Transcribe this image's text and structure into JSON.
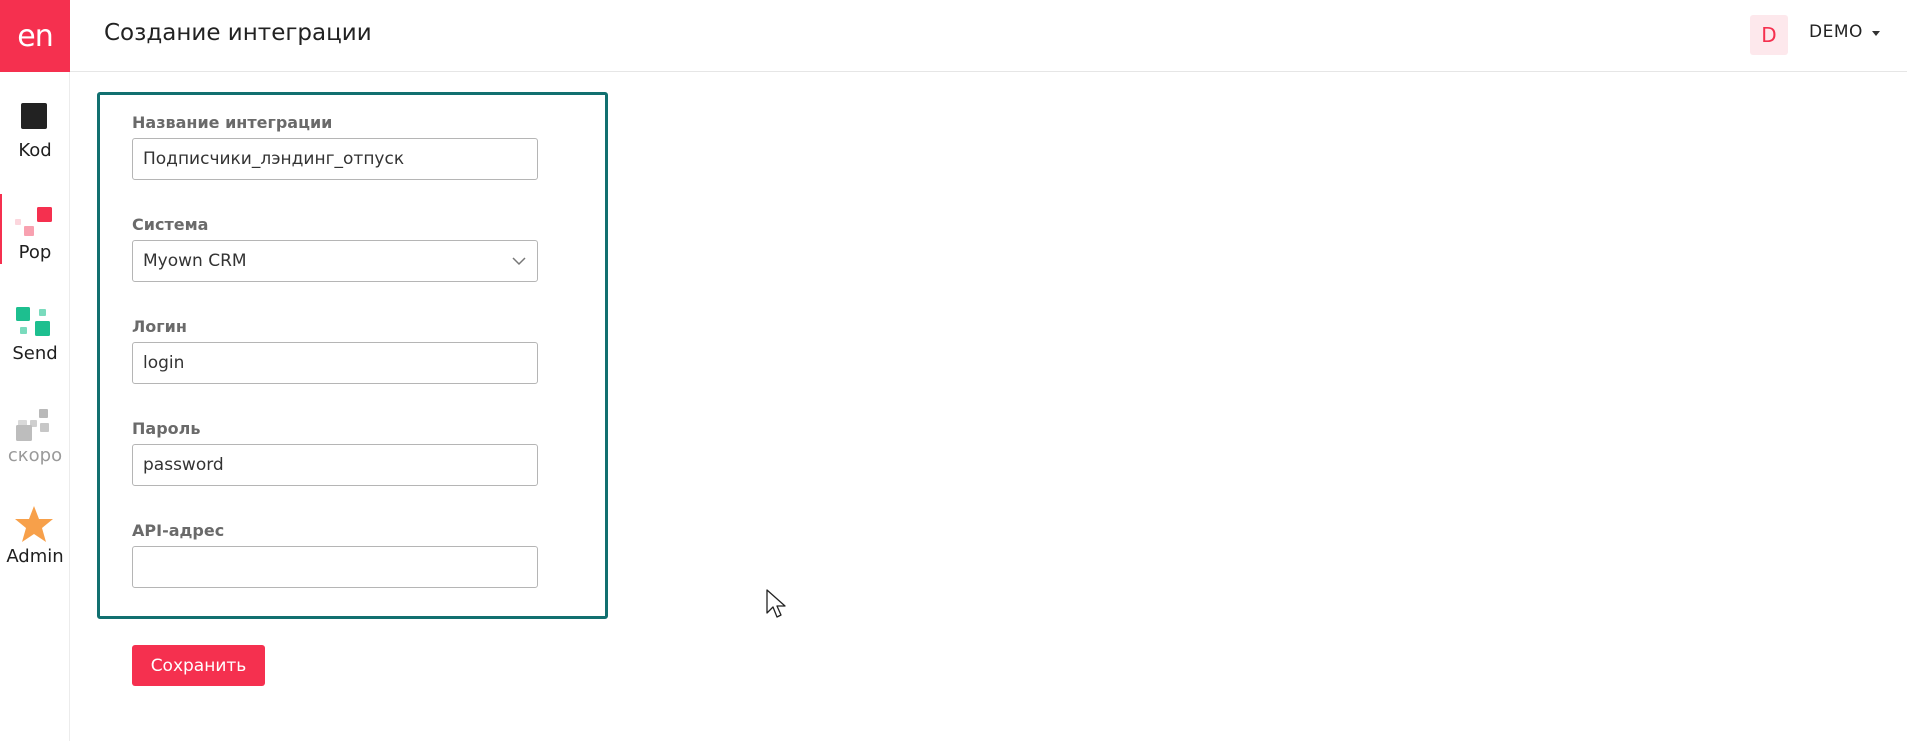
{
  "app": {
    "logo_text": "en",
    "brand_color": "#f5304f"
  },
  "sidebar": {
    "items": [
      {
        "label": "Kod",
        "icon": "square-icon"
      },
      {
        "label": "Pop",
        "icon": "pop-squares-icon",
        "active": true
      },
      {
        "label": "Send",
        "icon": "send-squares-icon"
      },
      {
        "label": "скоро",
        "icon": "soon-squares-icon",
        "disabled": true
      },
      {
        "label": "Admin",
        "icon": "star-icon"
      }
    ]
  },
  "header": {
    "title": "Создание интеграции",
    "avatar_letter": "D",
    "user_name": "DEMO"
  },
  "form": {
    "accent_color": "#117070",
    "fields": {
      "name": {
        "label": "Название интеграции",
        "value": "Подписчики_лэндинг_отпуск"
      },
      "system": {
        "label": "Система",
        "value": "Myown CRM"
      },
      "login": {
        "label": "Логин",
        "value": "login"
      },
      "password": {
        "label": "Пароль",
        "value": "password"
      },
      "api": {
        "label": "API-адрес",
        "value": ""
      }
    },
    "save_label": "Сохранить"
  }
}
